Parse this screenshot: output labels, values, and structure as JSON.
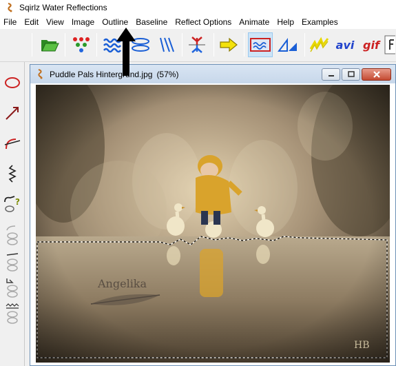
{
  "app": {
    "title": "Sqirlz Water Reflections"
  },
  "menu": {
    "items": [
      "File",
      "Edit",
      "View",
      "Image",
      "Outline",
      "Baseline",
      "Reflect Options",
      "Animate",
      "Help",
      "Examples"
    ]
  },
  "toolbar": {
    "avi_label": "avi",
    "gif_label": "gif",
    "buttons": [
      {
        "name": "open-folder",
        "icon": "folder-open-icon"
      },
      {
        "name": "colour-dots",
        "icon": "colour-dots-icon"
      },
      {
        "name": "water-waves",
        "icon": "wave-lines-icon"
      },
      {
        "name": "wave-ovals",
        "icon": "wave-ovals-icon"
      },
      {
        "name": "rain-lines",
        "icon": "rain-lines-icon"
      },
      {
        "name": "reflect-tree",
        "icon": "reflect-tree-icon"
      },
      {
        "name": "apply-arrow",
        "icon": "right-arrow-icon"
      },
      {
        "name": "water-preview",
        "icon": "water-preview-icon",
        "active": true
      },
      {
        "name": "perspective",
        "icon": "perspective-icon"
      },
      {
        "name": "lightning",
        "icon": "lightning-icon"
      },
      {
        "name": "save-avi",
        "icon": "avi-icon"
      },
      {
        "name": "save-gif",
        "icon": "gif-icon"
      },
      {
        "name": "flash",
        "icon": "flash-icon"
      }
    ]
  },
  "leftbar": {
    "tools": [
      "ellipse-tool-icon",
      "line-arrow-tool-icon",
      "arc-tool-icon",
      "zigzag-tool-icon",
      "shape-help-icon",
      "slot-1-icon",
      "slot-2-icon",
      "slot-3-icon",
      "slot-4-icon"
    ]
  },
  "document": {
    "filename": "Puddle Pals Hintergrund.jpg",
    "zoom": "(57%)"
  },
  "canvas": {
    "watermark": "Angelika",
    "signature": "HB"
  },
  "colors": {
    "accent": "#0066cc",
    "close_button": "#c44a32",
    "raincoat": "#d8a22c",
    "red_icon": "#cc2222"
  }
}
